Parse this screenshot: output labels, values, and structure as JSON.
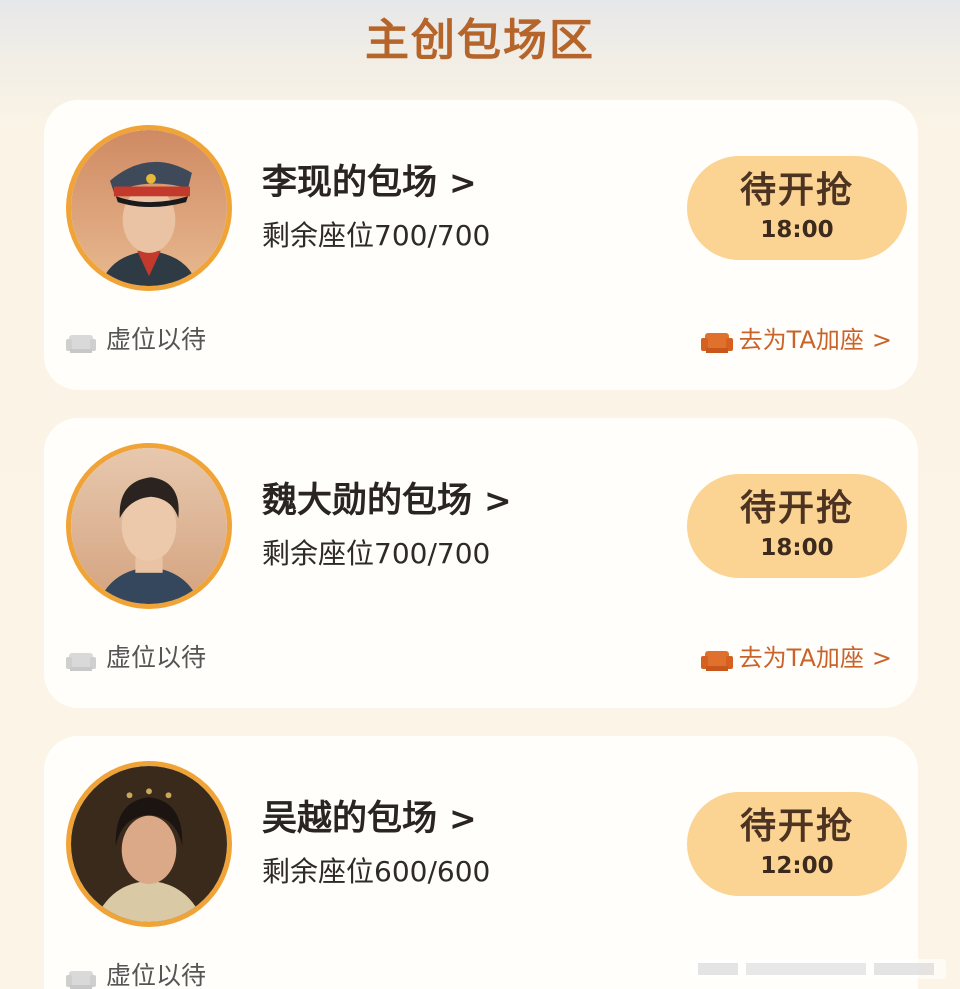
{
  "section": {
    "title": "主创包场区"
  },
  "cards": [
    {
      "name": "李现的包场",
      "chevron": ">",
      "seats": "剩余座位700/700",
      "button": {
        "label": "待开抢",
        "time": "18:00"
      },
      "reserve_label": "虚位以待",
      "add_seat_label": "去为TA加座",
      "add_seat_chevron": ">"
    },
    {
      "name": "魏大勋的包场",
      "chevron": ">",
      "seats": "剩余座位700/700",
      "button": {
        "label": "待开抢",
        "time": "18:00"
      },
      "reserve_label": "虚位以待",
      "add_seat_label": "去为TA加座",
      "add_seat_chevron": ">"
    },
    {
      "name": "吴越的包场",
      "chevron": ">",
      "seats": "剩余座位600/600",
      "button": {
        "label": "待开抢",
        "time": "12:00"
      },
      "reserve_label": "虚位以待"
    }
  ],
  "colors": {
    "title": "#b5652a",
    "button_bg": "#fbd392",
    "avatar_border": "#f0a437",
    "add_seat": "#c9632a"
  },
  "icons": {
    "reserve": "sofa-icon-gray",
    "add_seat": "sofa-icon-orange"
  }
}
